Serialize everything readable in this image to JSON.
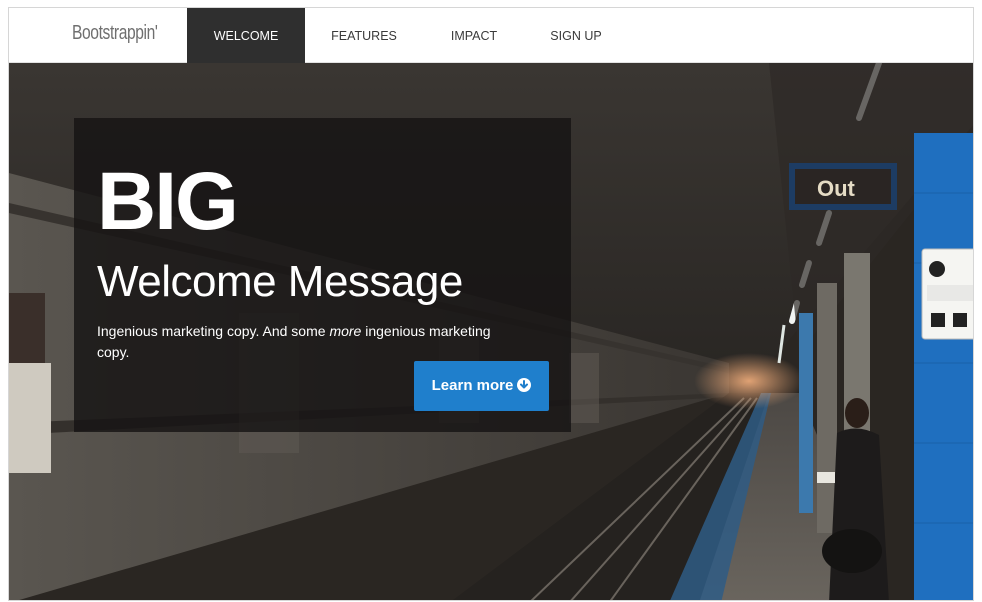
{
  "navbar": {
    "brand": "Bootstrappin'",
    "items": [
      {
        "label": "WELCOME",
        "active": true
      },
      {
        "label": "FEATURES",
        "active": false
      },
      {
        "label": "IMPACT",
        "active": false
      },
      {
        "label": "SIGN UP",
        "active": false
      }
    ]
  },
  "hero": {
    "big_text": "BIG",
    "headline": "Welcome Message",
    "copy_before": "Ingenious marketing copy. And some ",
    "copy_emphasis": "more",
    "copy_after": " ingenious marketing copy.",
    "cta_label": "Learn more",
    "cta_icon": "circle-arrow-down-icon",
    "sign_text": "Out",
    "colors": {
      "cta": "#1f7fcc",
      "nav_active": "#2f2f2f",
      "panel": "#161413"
    }
  }
}
